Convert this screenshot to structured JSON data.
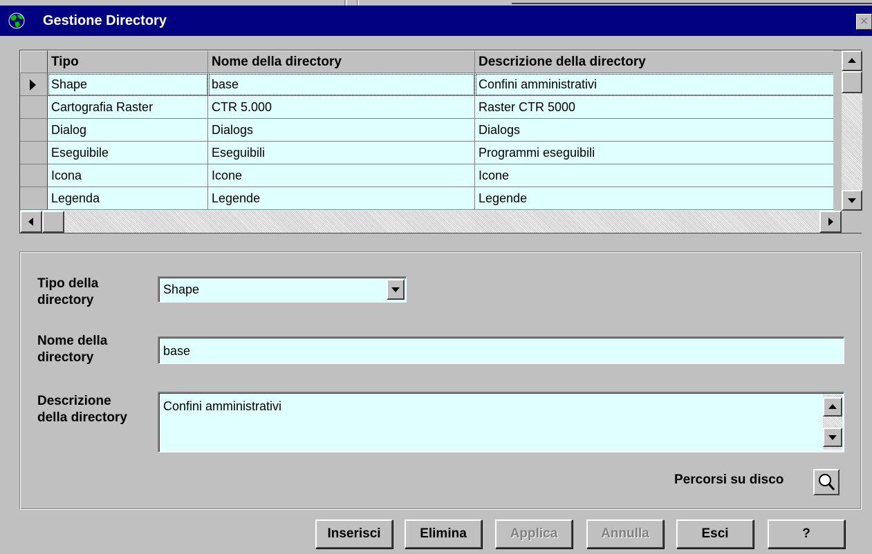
{
  "window": {
    "title": "Gestione Directory",
    "close_glyph": "×"
  },
  "grid": {
    "columns": [
      "Tipo",
      "Nome della directory",
      "Descrizione della directory"
    ],
    "rows": [
      {
        "tipo": "Shape",
        "nome": "base",
        "descrizione": "Confini amministrativi",
        "selected": true
      },
      {
        "tipo": "Cartografia Raster",
        "nome": "CTR 5.000",
        "descrizione": "Raster CTR 5000",
        "selected": false
      },
      {
        "tipo": "Dialog",
        "nome": "Dialogs",
        "descrizione": "Dialogs",
        "selected": false
      },
      {
        "tipo": "Eseguibile",
        "nome": "Eseguibili",
        "descrizione": "Programmi eseguibili",
        "selected": false
      },
      {
        "tipo": "Icona",
        "nome": "Icone",
        "descrizione": "Icone",
        "selected": false
      },
      {
        "tipo": "Legenda",
        "nome": "Legende",
        "descrizione": "Legende",
        "selected": false
      }
    ]
  },
  "form": {
    "tipo_label_1": "Tipo della",
    "tipo_label_2": "directory",
    "tipo_value": "Shape",
    "nome_label_1": "Nome della",
    "nome_label_2": "directory",
    "nome_value": "base",
    "descr_label_1": "Descrizione",
    "descr_label_2": "della directory",
    "descr_value": "Confini amministrativi",
    "percorsi_label": "Percorsi su disco"
  },
  "buttons": {
    "inserisci": "Inserisci",
    "elimina": "Elimina",
    "applica": "Applica",
    "annulla": "Annulla",
    "esci": "Esci",
    "help": "?"
  },
  "colors": {
    "title_bar": "#000080",
    "field_bg": "#e0ffff",
    "face": "#c0c0c0"
  }
}
